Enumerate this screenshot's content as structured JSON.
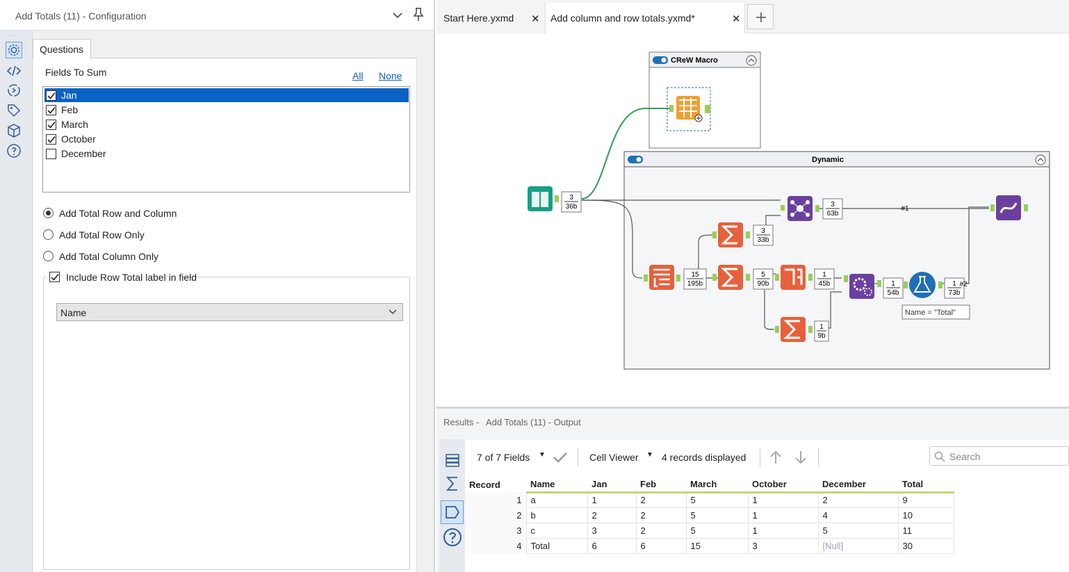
{
  "config": {
    "title": "Add Totals (11) - Configuration",
    "tab": "Questions",
    "fields_to_sum_label": "Fields To Sum",
    "link_all": "All",
    "link_none": "None",
    "fields": [
      {
        "label": "Jan",
        "checked": true,
        "selected": true
      },
      {
        "label": "Feb",
        "checked": true
      },
      {
        "label": "March",
        "checked": true
      },
      {
        "label": "October",
        "checked": true
      },
      {
        "label": "December",
        "checked": false
      }
    ],
    "options": [
      {
        "label": "Add Total Row and Column",
        "selected": true
      },
      {
        "label": "Add Total Row Only",
        "selected": false
      },
      {
        "label": "Add Total Column Only",
        "selected": false
      }
    ],
    "include_label": "Include Row Total label in field",
    "label_field": "Name"
  },
  "tabs": [
    {
      "label": "Start Here.yxmd",
      "active": false
    },
    {
      "label": "Add column and row totals.yxmd*",
      "active": true
    }
  ],
  "canvas": {
    "container_crew": "CReW Macro",
    "container_dynamic": "Dynamic",
    "formula_note": "Name = \"Total\"",
    "badges": {
      "input": {
        "count": "3",
        "size": "36b"
      },
      "join": {
        "count": "3",
        "size": "63b"
      },
      "sum_top": {
        "count": "3",
        "size": "33b"
      },
      "transpose": {
        "count": "15",
        "size": "195b"
      },
      "sum_mid": {
        "count": "5",
        "size": "90b"
      },
      "crosstab": {
        "count": "1",
        "size": "45b"
      },
      "sum_low": {
        "count": "1",
        "size": "9b"
      },
      "append": {
        "count": "1",
        "size": "54b"
      },
      "formula": {
        "count": "1",
        "size": "73b"
      }
    },
    "conn_labels": {
      "n1": "#1",
      "n2": "#2"
    }
  },
  "results": {
    "header_prefix": "Results -",
    "header_tool": "Add Totals (11) - Output",
    "fields_label": "7 of 7 Fields",
    "cell_viewer": "Cell Viewer",
    "records": "4 records displayed",
    "search_placeholder": "Search",
    "columns": [
      "Record",
      "Name",
      "Jan",
      "Feb",
      "March",
      "October",
      "December",
      "Total"
    ],
    "rows": [
      [
        "1",
        "a",
        "1",
        "2",
        "5",
        "1",
        "2",
        "9"
      ],
      [
        "2",
        "b",
        "2",
        "2",
        "5",
        "1",
        "4",
        "10"
      ],
      [
        "3",
        "c",
        "3",
        "2",
        "5",
        "1",
        "5",
        "11"
      ],
      [
        "4",
        "Total",
        "6",
        "6",
        "15",
        "3",
        "[Null]",
        "30"
      ]
    ]
  },
  "colors": {
    "accent_blue": "#0a63c4",
    "connection_green": "#2e9e4f",
    "tool_orange": "#e8603c",
    "tool_purple": "#6b3fa0",
    "tool_teal": "#16a085",
    "tool_blue": "#1f6fb5"
  }
}
